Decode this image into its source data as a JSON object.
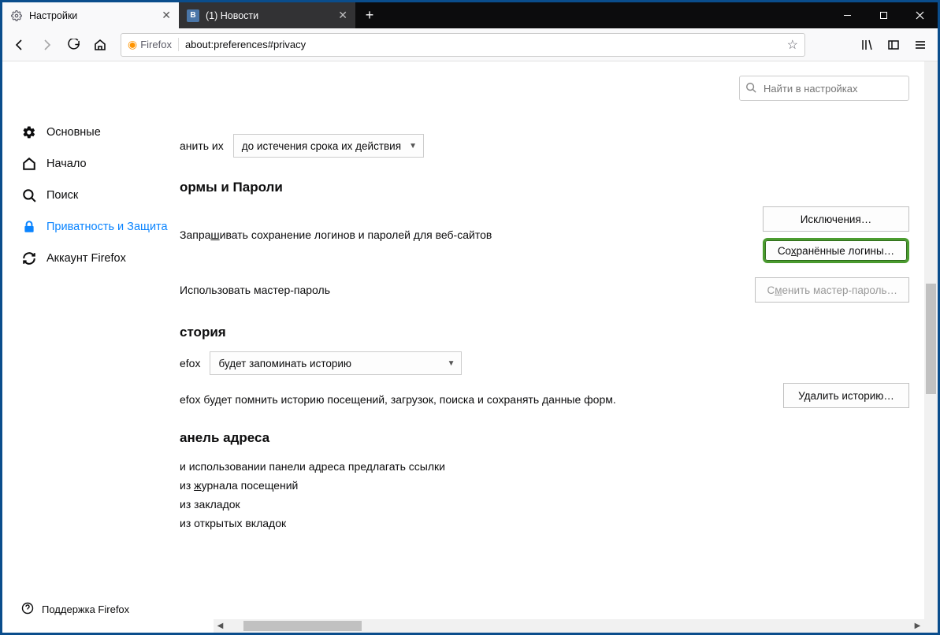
{
  "tabs": [
    {
      "title": "Настройки",
      "active": true
    },
    {
      "title": "(1) Новости",
      "active": false
    }
  ],
  "window": {
    "minimize": "—",
    "maximize": "□",
    "close": "✕",
    "newtab": "+"
  },
  "urlbar": {
    "badge": "Firefox",
    "url": "about:preferences#privacy"
  },
  "sidebar": {
    "items": [
      {
        "label": "Основные"
      },
      {
        "label": "Начало"
      },
      {
        "label": "Поиск"
      },
      {
        "label": "Приватность и Защита"
      },
      {
        "label": "Аккаунт Firefox"
      }
    ],
    "support": "Поддержка Firefox"
  },
  "search": {
    "placeholder": "Найти в настройках"
  },
  "cookies": {
    "keep_fragment": "анить их",
    "keep_select": "до истечения срока их действия"
  },
  "forms": {
    "heading": "ормы и Пароли",
    "ask_save": "Запрашивать сохранение логинов и паролей для веб-сайтов",
    "exceptions_btn": "Исключения…",
    "saved_logins_btn": "Сохранённые логины…",
    "master_pw": "Использовать мастер-пароль",
    "change_master_btn": "Сменить мастер-пароль…"
  },
  "history": {
    "heading": "стория",
    "prefix": "efox",
    "mode_select": "будет запоминать историю",
    "desc": "efox будет помнить историю посещений, загрузок, поиска и сохранять данные форм.",
    "clear_btn": "Удалить историю…"
  },
  "addressbar": {
    "heading": "анель адреса",
    "intro": "и использовании панели адреса предлагать ссылки",
    "opt1": "из журнала посещений",
    "opt2": "из закладок",
    "opt3": "из открытых вкладок"
  }
}
